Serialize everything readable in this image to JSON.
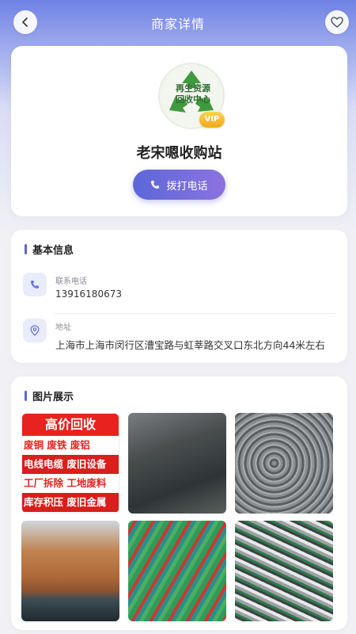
{
  "header": {
    "title": "商家详情"
  },
  "profile": {
    "logo_text_line1": "再生资源",
    "logo_text_line2": "回收中心",
    "vip_label": "VIP",
    "shop_name": "老宋嗯收购站",
    "call_button_label": "拨打电话"
  },
  "basic_info": {
    "section_title": "基本信息",
    "phone_label": "联系电话",
    "phone_value": "13916180673",
    "address_label": "地址",
    "address_value": "上海市上海市闵行区漕宝路与虹莘路交叉口东北方向44米左右"
  },
  "photos": {
    "section_title": "图片展示",
    "ad_title": "高价回收",
    "ad_lines": [
      "废铜 废铁 废铝",
      "电线电缆 废旧设备",
      "工厂拆除 工地废料",
      "库存积压 废旧金属"
    ]
  },
  "colors": {
    "accent": "#5b67d8",
    "header_gradient_start": "#6e82e4",
    "vip": "#f0a81c"
  }
}
